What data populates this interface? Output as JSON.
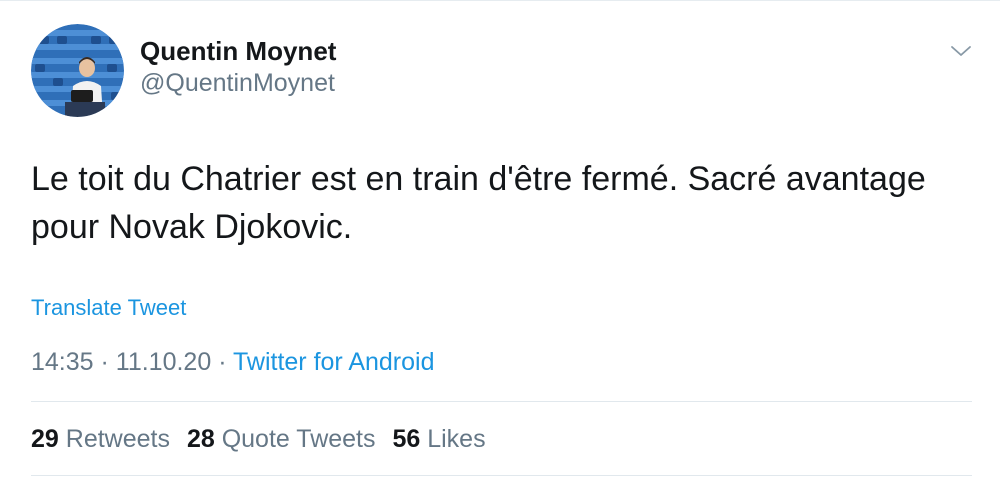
{
  "user": {
    "display_name": "Quentin Moynet",
    "handle": "@QuentinMoynet"
  },
  "tweet": {
    "text": "Le toit du Chatrier est en train d'être fermé. Sacré avantage pour Novak Djokovic.",
    "translate_label": "Translate Tweet"
  },
  "meta": {
    "time": "14:35",
    "separator1": " · ",
    "date": "11.10.20",
    "separator2": " · ",
    "source": "Twitter for Android"
  },
  "stats": {
    "retweets_count": "29",
    "retweets_label": "Retweets",
    "quotes_count": "28",
    "quotes_label": "Quote Tweets",
    "likes_count": "56",
    "likes_label": "Likes"
  },
  "icons": {
    "menu": "chevron-down-icon"
  },
  "colors": {
    "link": "#1b95e0",
    "secondary_text": "#657786",
    "primary_text": "#14171a",
    "divider": "#e1e8ed"
  }
}
